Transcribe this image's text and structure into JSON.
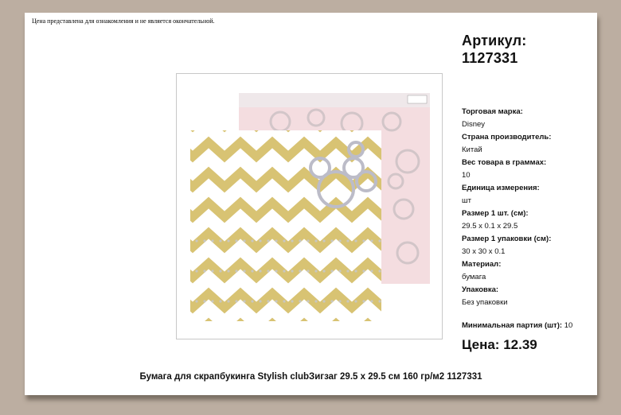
{
  "disclaimer": "Цена представлена для ознакомления и не является окончательной.",
  "article": {
    "label": "Артикул:",
    "value": "1127331"
  },
  "specs": [
    {
      "label": "Торговая марка:",
      "value": "Disney"
    },
    {
      "label": "Страна производитель:",
      "value": "Китай"
    },
    {
      "label": "Вес товара в граммах:",
      "value": "10"
    },
    {
      "label": "Единица измерения:",
      "value": "шт"
    },
    {
      "label": "Размер 1 шт. (см):",
      "value": "29.5 x 0.1 x 29.5"
    },
    {
      "label": "Размер 1 упаковки (см):",
      "value": "30 x 30 x 0.1"
    },
    {
      "label": "Материал:",
      "value": "бумага"
    },
    {
      "label": "Упаковка:",
      "value": "Без упаковки"
    }
  ],
  "min_batch": {
    "label": "Минимальная партия (шт):",
    "value": "10"
  },
  "price": {
    "label": "Цена:",
    "value": "12.39"
  },
  "caption": "Бумага для скрапбукинга Stylish clubЗигзаг 29.5 x 29.5 см 160 гр/м2 1127331",
  "product_image": {
    "icon": "scrapbook-paper-image"
  },
  "colors": {
    "background": "#bcaea1",
    "paper_gold": "#d8c373",
    "paper_pink": "#f4dde0"
  }
}
